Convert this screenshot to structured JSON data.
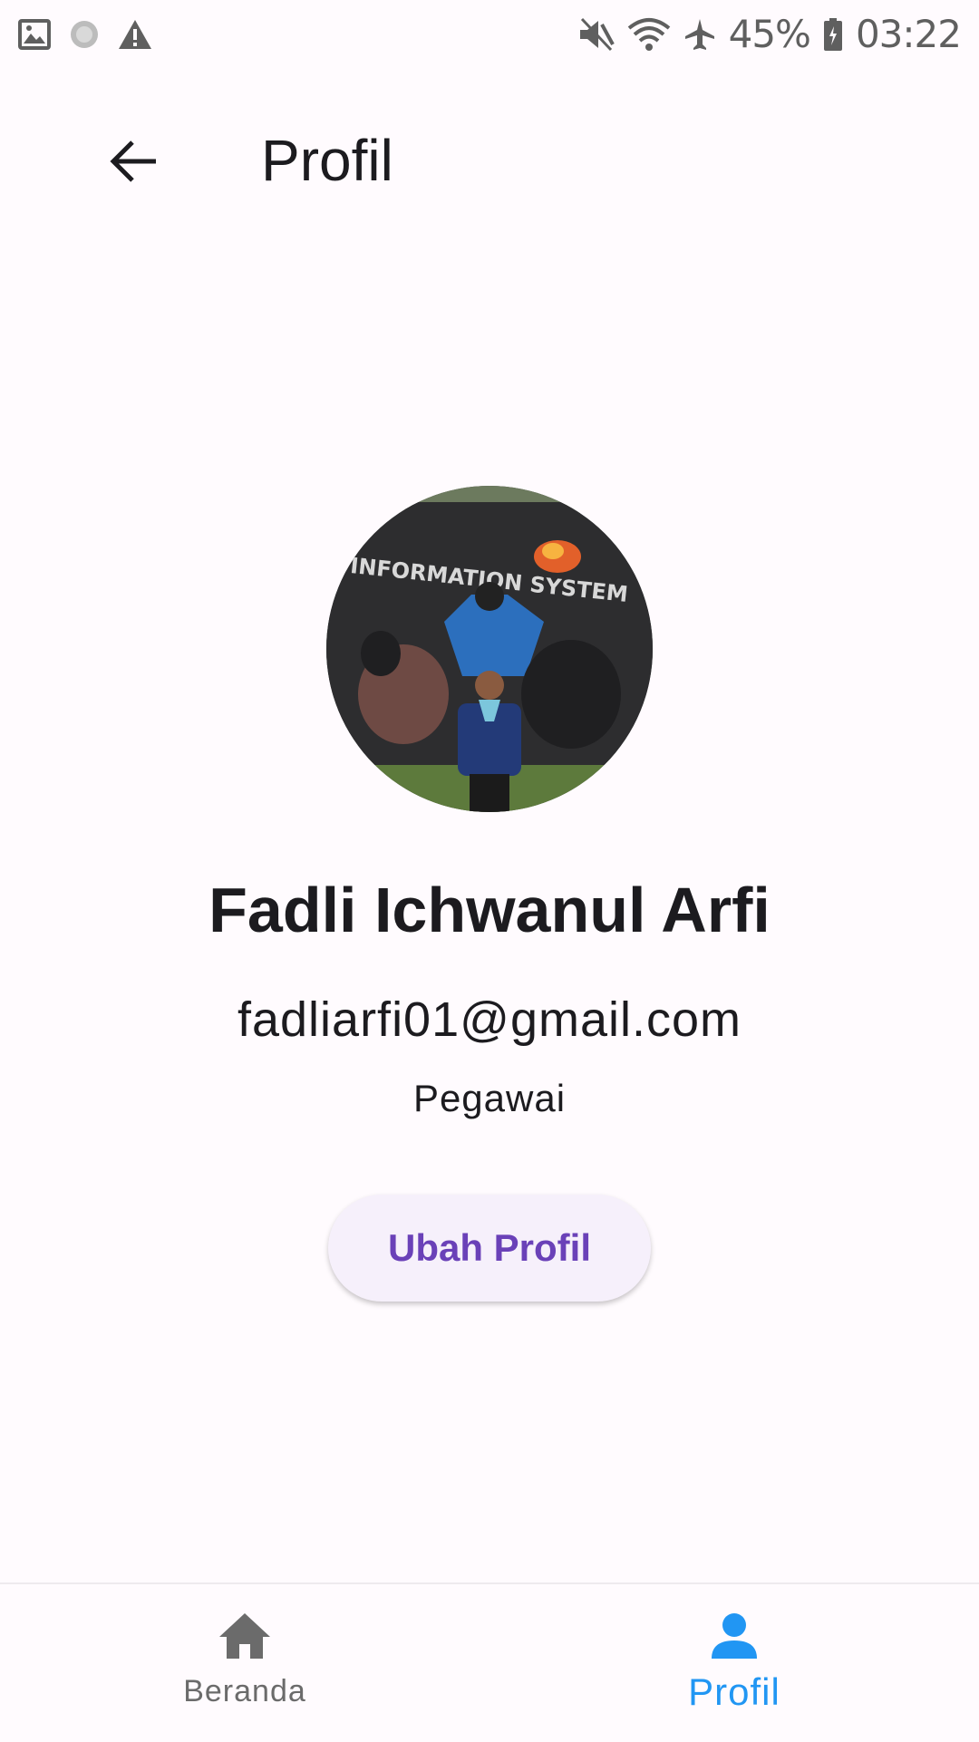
{
  "status_bar": {
    "battery": "45%",
    "time": "03:22",
    "icons_left": [
      "image-icon",
      "loading-icon",
      "warning-icon"
    ],
    "icons_right": [
      "vibrate-mute-icon",
      "wifi-icon",
      "airplane-icon",
      "battery-icon"
    ]
  },
  "app_bar": {
    "title": "Profil",
    "back_icon": "arrow-back-icon"
  },
  "profile": {
    "name": "Fadli Ichwanul Arfi",
    "email": "fadliarfi01@gmail.com",
    "role": "Pegawai",
    "avatar_banner_text": "INFORMATION SYSTEM",
    "edit_button_label": "Ubah Profil"
  },
  "bottom_nav": {
    "items": [
      {
        "label": "Beranda",
        "icon": "home-icon",
        "active": false
      },
      {
        "label": "Profil",
        "icon": "person-icon",
        "active": true
      }
    ]
  },
  "colors": {
    "background": "#fffbfe",
    "primary_button_text": "#6a41b8",
    "button_bg": "#f6f0fb",
    "nav_active": "#2196f3",
    "nav_inactive": "#6b6b6b"
  }
}
